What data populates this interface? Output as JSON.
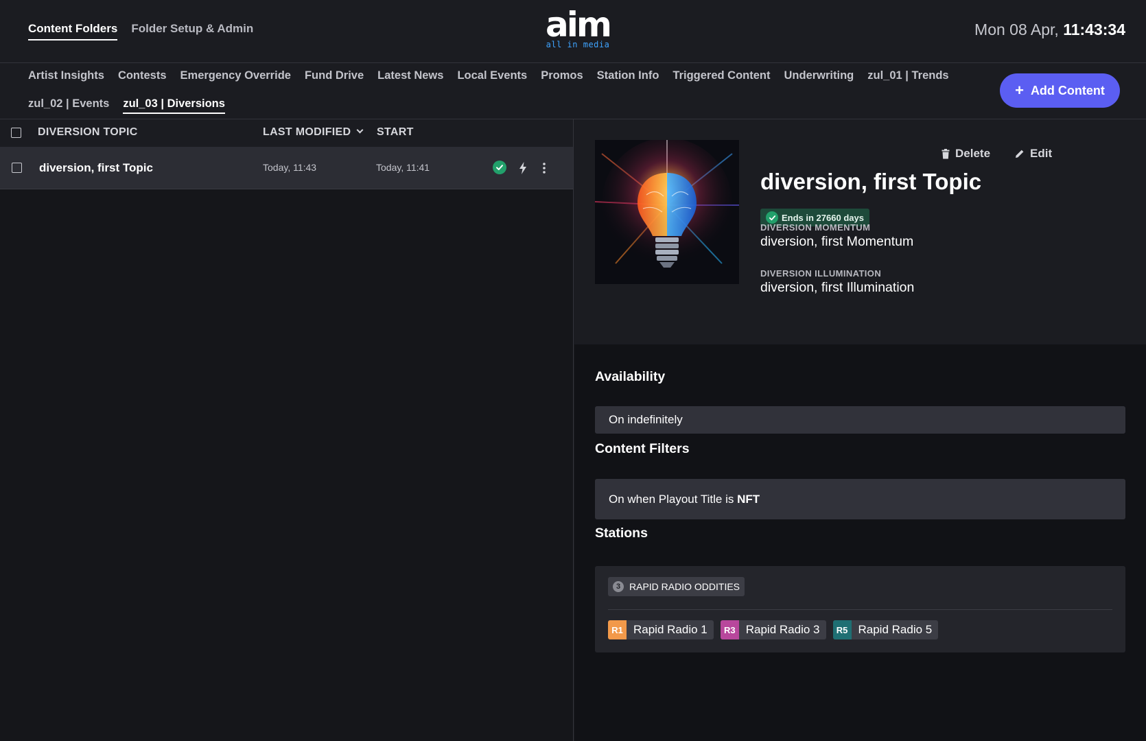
{
  "top_nav": {
    "content_folders": "Content Folders",
    "folder_setup": "Folder Setup & Admin"
  },
  "logo": {
    "word": "aim",
    "tagline": "all in media"
  },
  "clock": {
    "date": "Mon 08 Apr,",
    "time": "11:43:34"
  },
  "categories": {
    "row1": [
      "Artist Insights",
      "Contests",
      "Emergency Override",
      "Fund Drive",
      "Latest News",
      "Local Events",
      "Promos",
      "Station Info",
      "Triggered Content",
      "Underwriting",
      "zul_01 | Trends"
    ],
    "row2": [
      "zul_02 | Events",
      "zul_03 | Diversions"
    ],
    "active": "zul_03 | Diversions"
  },
  "add_button": {
    "label": "Add Content",
    "color": "#5b5ef2"
  },
  "table": {
    "headers": {
      "topic": "DIVERSION TOPIC",
      "last_modified": "LAST MODIFIED",
      "start": "START"
    },
    "rows": [
      {
        "title": "diversion, first Topic",
        "last_modified": "Today, 11:43",
        "start": "Today, 11:41",
        "status": "active"
      }
    ]
  },
  "detail": {
    "title": "diversion, first Topic",
    "ends_badge": "Ends in 27660 days",
    "momentum_label": "DIVERSION MOMENTUM",
    "momentum_value": "diversion, first Momentum",
    "illumination_label": "DIVERSION ILLUMINATION",
    "illumination_value": "diversion, first Illumination",
    "delete_label": "Delete",
    "edit_label": "Edit",
    "image_icon": "lightbulb-brain-image"
  },
  "availability": {
    "heading": "Availability",
    "value": "On indefinitely"
  },
  "content_filters": {
    "heading": "Content Filters",
    "prefix": "On when Playout Title is",
    "value": "NFT"
  },
  "stations": {
    "heading": "Stations",
    "group": {
      "count": "3",
      "name": "RAPID RADIO ODDITIES"
    },
    "list": [
      {
        "code": "R1",
        "name": "Rapid Radio 1",
        "color": "#f2994a"
      },
      {
        "code": "R3",
        "name": "Rapid Radio 3",
        "color": "#b8479c"
      },
      {
        "code": "R5",
        "name": "Rapid Radio 5",
        "color": "#1f6f73"
      }
    ]
  },
  "colors": {
    "success": "#22a06b",
    "accent": "#5b5ef2",
    "background": "#1b1c21"
  }
}
